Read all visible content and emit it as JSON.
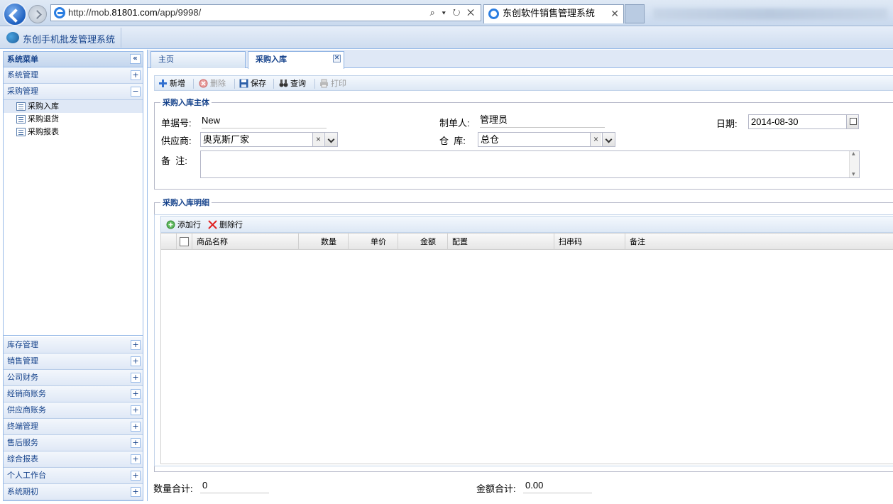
{
  "browser": {
    "url_prefix": "http://mob.",
    "url_domain": "81801.com",
    "url_path": "/app/9998/",
    "addr_controls": "⌕ ▾ ↻ ✕",
    "tab_title": "东创软件销售管理系统",
    "tab_close": "✕"
  },
  "app": {
    "title": "东创手机批发管理系统"
  },
  "sidebar": {
    "header": "系统菜单",
    "collapse": "«",
    "groups_top": [
      {
        "label": "系统管理",
        "toggle": "+"
      },
      {
        "label": "采购管理",
        "toggle": "−"
      }
    ],
    "leaves": [
      {
        "label": "采购入库"
      },
      {
        "label": "采购退货"
      },
      {
        "label": "采购报表"
      }
    ],
    "groups_bottom": [
      {
        "label": "库存管理",
        "toggle": "+"
      },
      {
        "label": "销售管理",
        "toggle": "+"
      },
      {
        "label": "公司财务",
        "toggle": "+"
      },
      {
        "label": "经销商账务",
        "toggle": "+"
      },
      {
        "label": "供应商账务",
        "toggle": "+"
      },
      {
        "label": "终端管理",
        "toggle": "+"
      },
      {
        "label": "售后服务",
        "toggle": "+"
      },
      {
        "label": "综合报表",
        "toggle": "+"
      },
      {
        "label": "个人工作台",
        "toggle": "+"
      },
      {
        "label": "系统期初",
        "toggle": "+"
      }
    ]
  },
  "tabs": [
    {
      "label": "主页"
    },
    {
      "label": "采购入库",
      "close": "✕"
    }
  ],
  "toolbar": {
    "add": "新增",
    "delete": "删除",
    "save": "保存",
    "query": "查询",
    "print": "打印"
  },
  "master": {
    "legend": "采购入库主体",
    "doc_no_label": "单据号:",
    "doc_no_value": "New",
    "maker_label": "制单人:",
    "maker_value": "管理员",
    "date_label": "日期:",
    "date_value": "2014-08-30",
    "supplier_label": "供应商:",
    "supplier_value": "奥克斯厂家",
    "warehouse_label": "仓  库:",
    "warehouse_value": "总仓",
    "remarks_label": "备  注:",
    "clear_glyph": "×"
  },
  "detail": {
    "legend": "采购入库明细",
    "add_row": "添加行",
    "delete_row": "删除行",
    "columns": [
      "商品名称",
      "数量",
      "单价",
      "金额",
      "配置",
      "扫串码",
      "备注"
    ]
  },
  "footer": {
    "qty_total_label": "数量合计:",
    "qty_total_value": "0",
    "amount_total_label": "金额合计:",
    "amount_total_value": "0.00"
  }
}
